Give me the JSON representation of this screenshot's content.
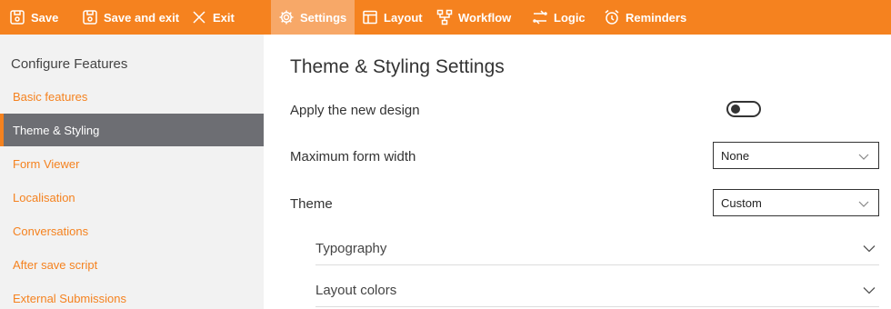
{
  "toolbar": {
    "save": "Save",
    "save_exit": "Save and exit",
    "exit": "Exit",
    "settings": "Settings",
    "layout": "Layout",
    "workflow": "Workflow",
    "logic": "Logic",
    "reminders": "Reminders",
    "active_tab": "Settings"
  },
  "sidebar": {
    "title": "Configure Features",
    "items": [
      {
        "label": "Basic features"
      },
      {
        "label": "Theme & Styling",
        "active": true
      },
      {
        "label": "Form Viewer"
      },
      {
        "label": "Localisation"
      },
      {
        "label": "Conversations"
      },
      {
        "label": "After save script"
      },
      {
        "label": "External Submissions"
      }
    ]
  },
  "main": {
    "title": "Theme & Styling Settings",
    "apply_design": {
      "label": "Apply the new design",
      "enabled": false
    },
    "max_width": {
      "label": "Maximum form width",
      "value": "None"
    },
    "theme": {
      "label": "Theme",
      "value": "Custom"
    },
    "sections": [
      {
        "label": "Typography"
      },
      {
        "label": "Layout colors"
      }
    ]
  },
  "colors": {
    "accent": "#f5821f",
    "active_tab_bg": "#f7a868",
    "sidebar_bg": "#f2f2f2",
    "sidebar_active_bg": "#6d6e73"
  }
}
